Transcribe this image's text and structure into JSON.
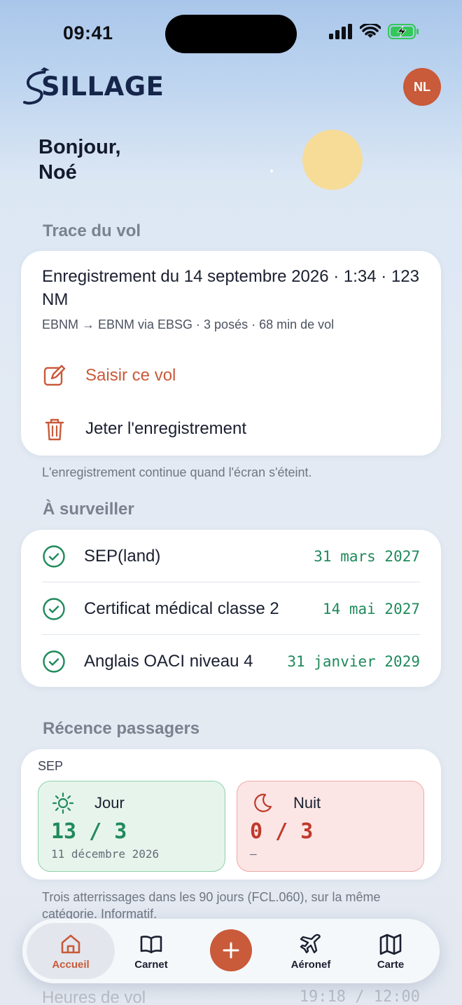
{
  "status_bar": {
    "time": "09:41"
  },
  "header": {
    "logo_text": "SILLAGE",
    "avatar_initials": "NL"
  },
  "greeting": {
    "line1": "Bonjour,",
    "line2": "Noé"
  },
  "trace": {
    "section_title": "Trace du vol",
    "title": "Enregistrement du 14 septembre 2026 · 1:34 · 123 NM",
    "subtitle": "EBNM → EBNM via EBSG · 3 posés · 68 min de vol",
    "action_enter": "Saisir ce vol",
    "action_discard": "Jeter l'enregistrement",
    "note": "L'enregistrement continue quand l'écran s'éteint."
  },
  "watch": {
    "section_title": "À surveiller",
    "items": [
      {
        "name": "SEP(land)",
        "date": "31 mars 2027"
      },
      {
        "name": "Certificat médical classe 2",
        "date": "14 mai 2027"
      },
      {
        "name": "Anglais OACI niveau 4",
        "date": "31 janvier 2029"
      }
    ]
  },
  "passengers": {
    "section_title": "Récence passagers",
    "category": "SEP",
    "day": {
      "label": "Jour",
      "value": "13 / 3",
      "date": "11 décembre 2026"
    },
    "night": {
      "label": "Nuit",
      "value": "0 / 3",
      "date": "—"
    },
    "note": "Trois atterrissages dans les 90 jours (FCL.060), sur la même catégorie. Informatif."
  },
  "hours": {
    "label": "Heures de vol",
    "value": "19:18 / 12:00"
  },
  "tabbar": {
    "home": "Accueil",
    "logbook": "Carnet",
    "aircraft": "Aéronef",
    "map": "Carte"
  },
  "colors": {
    "accent": "#c95a3a",
    "ok_green": "#1f8a5b",
    "night_red": "#c0392b",
    "navy": "#16254a"
  }
}
